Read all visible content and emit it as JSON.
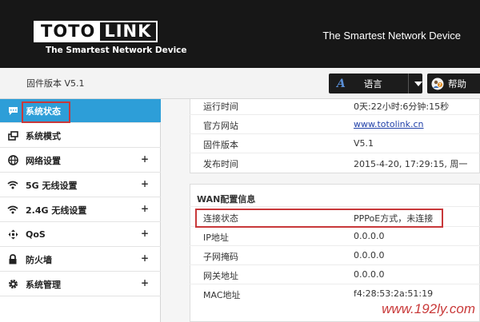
{
  "header": {
    "logo_left": "TOTO",
    "logo_right": "LINK",
    "logo_tagline": "The Smartest Network Device",
    "tagline": "The Smartest Network Device"
  },
  "subbar": {
    "firmware": "固件版本 V5.1",
    "language_icon": "A",
    "language_label": "语言",
    "help_label": "帮助"
  },
  "sidebar": {
    "items": [
      {
        "label": "系统状态",
        "icon": "chat-icon",
        "expandable": false,
        "active": true
      },
      {
        "label": "系统模式",
        "icon": "windows-icon",
        "expandable": false,
        "active": false
      },
      {
        "label": "网络设置",
        "icon": "globe-icon",
        "expandable": true,
        "active": false
      },
      {
        "label": "5G 无线设置",
        "icon": "wifi-icon",
        "expandable": true,
        "active": false
      },
      {
        "label": "2.4G 无线设置",
        "icon": "wifi-icon",
        "expandable": true,
        "active": false
      },
      {
        "label": "QoS",
        "icon": "arrows-icon",
        "expandable": true,
        "active": false
      },
      {
        "label": "防火墙",
        "icon": "lock-icon",
        "expandable": true,
        "active": false
      },
      {
        "label": "系统管理",
        "icon": "gear-icon",
        "expandable": true,
        "active": false
      }
    ],
    "plus": "+"
  },
  "system_info": {
    "rows": [
      {
        "label": "运行时间",
        "value": "0天:22小时:6分钟:15秒"
      },
      {
        "label": "官方网站",
        "value": "www.totolink.cn"
      },
      {
        "label": "固件版本",
        "value": "V5.1"
      },
      {
        "label": "发布时间",
        "value": "2015-4-20, 17:29:15, 周一"
      }
    ]
  },
  "wan_info": {
    "title": "WAN配置信息",
    "rows": [
      {
        "label": "连接状态",
        "value": "PPPoE方式，未连接"
      },
      {
        "label": "IP地址",
        "value": "0.0.0.0"
      },
      {
        "label": "子网掩码",
        "value": "0.0.0.0"
      },
      {
        "label": "网关地址",
        "value": "0.0.0.0"
      },
      {
        "label": "MAC地址",
        "value": "f4:28:53:2a:51:19"
      }
    ]
  },
  "watermark": "www.192ly.com",
  "colors": {
    "header_bg": "#171717",
    "active_nav": "#2d9ed8",
    "highlight": "#c8383a",
    "link": "#1f3fa8"
  }
}
